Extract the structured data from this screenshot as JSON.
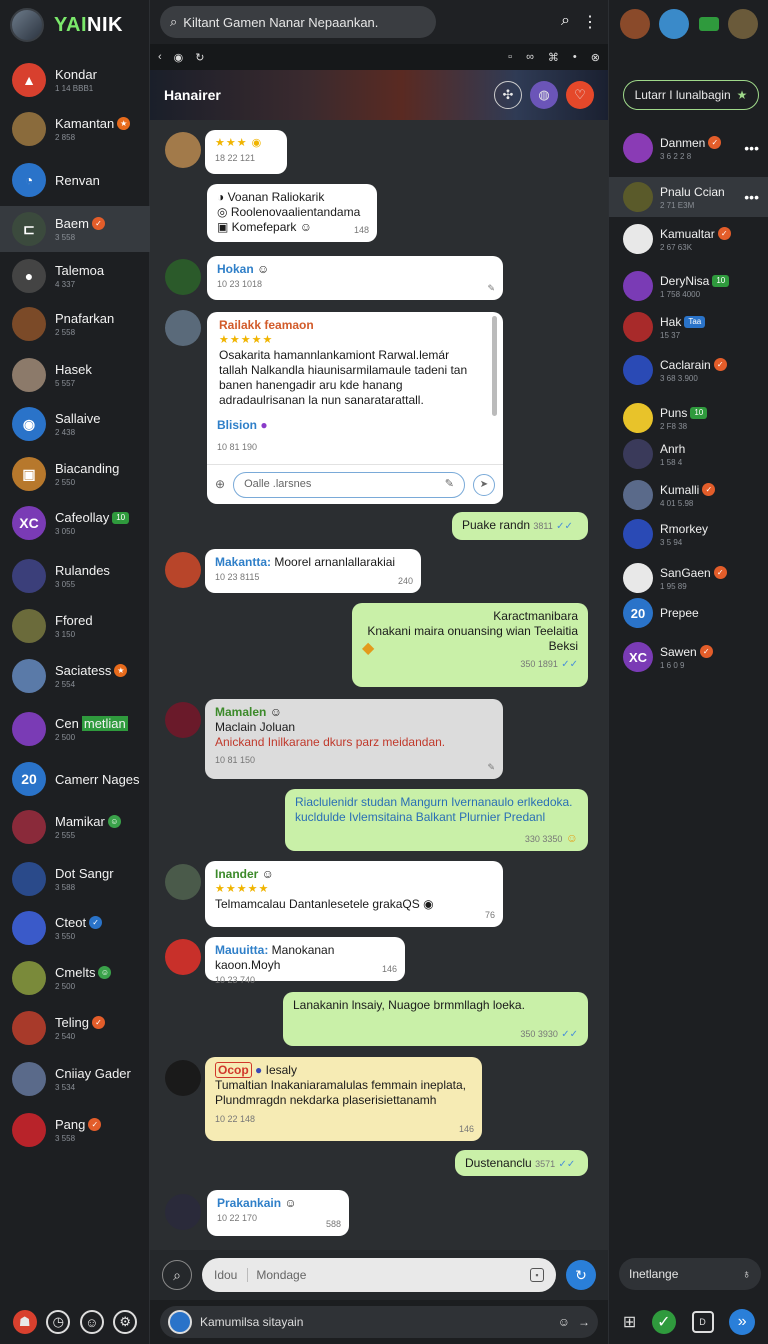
{
  "brand": {
    "text_green": "YAI",
    "text_white": "NIK"
  },
  "sidebar": {
    "items": [
      {
        "name": "Kondar",
        "sub": "1 14 BBB1",
        "letter": "▲",
        "color": "#d8402e"
      },
      {
        "name": "Kamantan",
        "sub": "2 858",
        "letter": "",
        "color": "#8a6b3c",
        "badge": "★",
        "badge_color": "#e86b1c"
      },
      {
        "name": "Renvan",
        "sub": "",
        "letter": "◔",
        "color": "#2a73c9"
      },
      {
        "name": "Baem",
        "sub": "3 558",
        "letter": "⊏",
        "color": "#3b4a3d",
        "badge": "✓",
        "badge_color": "#e35d2a",
        "active": true
      },
      {
        "name": "Talemoa",
        "sub": "4 337",
        "letter": "●",
        "color": "#444"
      },
      {
        "name": "Pnafarkan",
        "sub": "2 558",
        "letter": "",
        "color": "#7b4a28"
      },
      {
        "name": "Hasek",
        "sub": "5 557",
        "letter": "",
        "color": "#8c7a6a"
      },
      {
        "name": "Sallaive",
        "sub": "2 438",
        "letter": "◉",
        "color": "#2a73c9"
      },
      {
        "name": "Biacanding",
        "sub": "2 550",
        "letter": "▣",
        "color": "#b7782c"
      },
      {
        "name": "Cafeollay",
        "sub": "3 050",
        "letter": "XC",
        "color": "#7a3bb5",
        "badge": "10",
        "badge_color": "#2f9a3d",
        "pill": true
      },
      {
        "name": "Rulandes",
        "sub": "3 055",
        "letter": "",
        "color": "#3b3f7a"
      },
      {
        "name": "Ffored",
        "sub": "3 150",
        "letter": "",
        "color": "#6b6b3b"
      },
      {
        "name": "Saciatess",
        "sub": "2 554",
        "letter": "",
        "color": "#5a7aa8",
        "badge": "★",
        "badge_color": "#e86b1c"
      },
      {
        "name": "Cen",
        "name_hl": "metlian",
        "sub": "2 500",
        "letter": "",
        "color": "#7a3bb5"
      },
      {
        "name": "Camerr Nages",
        "sub": "",
        "letter": "20",
        "color": "#2a73c9"
      },
      {
        "name": "Mamikar",
        "sub": "2 555",
        "letter": "",
        "color": "#8a2a3a",
        "badge": "☺",
        "badge_color": "#3aa24a"
      },
      {
        "name": "Dot Sangr",
        "sub": "3 588",
        "letter": "",
        "color": "#2a4a8a"
      },
      {
        "name": "Cteot",
        "sub": "3 550",
        "letter": "",
        "color": "#3a5ac9",
        "badge": "✓",
        "badge_color": "#2a73c9"
      },
      {
        "name": "Cmelts",
        "sub": "2 500",
        "letter": "",
        "color": "#7a8a3a",
        "badge": "☺",
        "badge_color": "#3aa24a"
      },
      {
        "name": "Teling",
        "sub": "2 540",
        "letter": "",
        "color": "#a83a2a",
        "badge": "✓",
        "badge_color": "#e35d2a"
      },
      {
        "name": "Cniiay Gader",
        "sub": "3 534",
        "letter": "",
        "color": "#5a6a8a"
      },
      {
        "name": "Pang",
        "sub": "3 558",
        "letter": "",
        "color": "#b8232a",
        "badge": "✓",
        "badge_color": "#e35d2a"
      }
    ]
  },
  "topbar": {
    "search_text": "Kiltant Gamen Nanar Nepaankan."
  },
  "banner": {
    "title": "Hanairer"
  },
  "messages": {
    "m1": {
      "meta": "18 22 121"
    },
    "m2": {
      "lines": [
        "Voanan Raliokarik",
        "Roolenovaalientandama",
        "Komefepark"
      ],
      "meta": "148"
    },
    "m3": {
      "sender": "Hokan",
      "meta": "10 23 1018"
    },
    "m4": {
      "sender": "Railakk feamaon",
      "text": "Osakarita hamannlankamiont Rarwal.lemár tallah Nalkandla hiaunisarmilamaule tadeni tan banen hanengadir aru kde hanang adradaulrisanan la nun sanaratarattall."
    },
    "m5": {
      "sender": "Blision",
      "meta": "10 81 190",
      "placeholder": "Oalle .larsnes"
    },
    "m6": {
      "text": "Puake randn",
      "meta": "3811"
    },
    "m7": {
      "sender": "Makantta:",
      "text": "Moorel arnanlallarakiai",
      "meta": "10 23 8115",
      "meta_r": "240"
    },
    "m8": {
      "lines": [
        "Karactmanibara",
        "Knakani maira onuansing wian Teelaitia",
        "Beksi"
      ],
      "meta": "350 1891"
    },
    "m9": {
      "sender": "Mamalen",
      "line1": "Maclain Joluan",
      "line2": "Anickand Inilkarane dkurs parz meidandan.",
      "meta": "10 81 150"
    },
    "m10": {
      "text": "Riaclulenidr studan Mangurn Ivernanaulo erlkedoka. kucldulde Ivlemsitaina Balkant Plurnier Predanl",
      "meta": "330 3350"
    },
    "m11": {
      "sender": "Inander",
      "text": "Telmamcalau Dantanlesetele grakaQS",
      "meta": "76"
    },
    "m12": {
      "sender": "Mauuitta:",
      "text": "Manokanan kaoon.Moyh",
      "meta": "10 23 740",
      "meta_r": "146"
    },
    "m13": {
      "text": "Lanakanin lnsaiy, Nuagoe brmmllagh loeka.",
      "meta": "350 3930"
    },
    "m14": {
      "sender": "Ocop",
      "sender_after": "Iesaly",
      "text": "Tumaltian Inakaniaramalulas femmain ineplata, Plundmragdn nekdarka plaserisiettanamh",
      "meta": "10 22 148",
      "meta_r": "146"
    },
    "m15": {
      "text": "Dustenanclu",
      "meta": "3571"
    },
    "m16": {
      "sender": "Prakankain",
      "meta": "10 22 170",
      "meta_r": "588"
    }
  },
  "composer": {
    "label": "Idou",
    "placeholder": "Mondage"
  },
  "bottombar": {
    "text": "Kamumilsa sitayain"
  },
  "right": {
    "button": "Lutarr I lunalbagin",
    "items": [
      {
        "name": "Danmen",
        "sub": "3 6 2 2 8",
        "color": "#8a3bb5",
        "badge": "✓",
        "badge_color": "#e35d2a",
        "more": true
      },
      {
        "name": "Pnalu Ccian",
        "sub": "2 71 E3M",
        "color": "#5a5a2a",
        "active": true,
        "more": true
      },
      {
        "name": "Kamualtar",
        "sub": "2 67 63K",
        "color": "#e8e8e8",
        "badge": "✓",
        "badge_color": "#e35d2a"
      },
      {
        "name": "DeryNisa",
        "sub": "1 758 4000",
        "color": "#7a3bb5",
        "badge": "10",
        "badge_color": "#2f9a3d",
        "pill": true
      },
      {
        "name": "Hak",
        "sub": "15 37",
        "color": "#a82a2a",
        "badge": "Taa",
        "badge_color": "#2a73c9",
        "pill": true
      },
      {
        "name": "Caclarain",
        "sub": "3 68 3.900",
        "color": "#2a4ab5",
        "badge": "✓",
        "badge_color": "#e35d2a"
      },
      {
        "name": "Puns",
        "sub": "2 F8 38",
        "color": "#e8c32a",
        "badge": "10",
        "badge_color": "#2f9a3d",
        "pill": true
      },
      {
        "name": "Anrh",
        "sub": "1 58 4",
        "color": "#3a3a5a"
      },
      {
        "name": "Kumalli",
        "sub": "4 01 5.98",
        "color": "#5a6a8a",
        "badge": "✓",
        "badge_color": "#e35d2a"
      },
      {
        "name": "Rmorkey",
        "sub": "3 5 94",
        "color": "#2a4ab5"
      },
      {
        "name": "SanGaen",
        "sub": "1 95 89",
        "color": "#e8e8e8",
        "badge": "✓",
        "badge_color": "#e35d2a"
      },
      {
        "name": "Prepee",
        "sub": "",
        "color": "#2a73c9",
        "letter": "20"
      },
      {
        "name": "Sawen",
        "sub": "1 6 0 9",
        "color": "#7a3bb5",
        "letter": "XC",
        "badge": "✓",
        "badge_color": "#e35d2a"
      }
    ],
    "search": "Inetlange"
  },
  "colors": {
    "accent_green": "#c9f0a8",
    "accent_blue": "#2a73c9",
    "sidebar_bg": "#1d1f22",
    "chat_bg": "#2b2e31"
  }
}
